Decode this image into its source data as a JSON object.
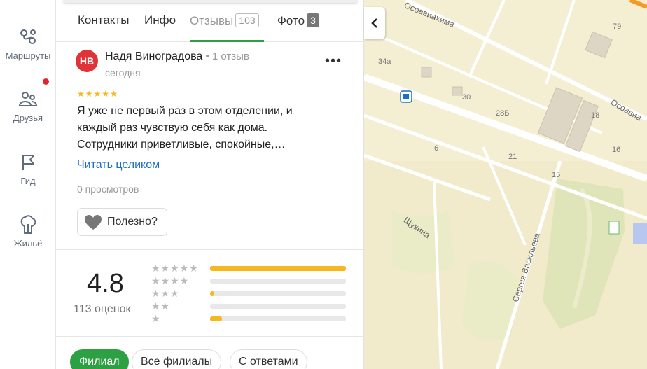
{
  "sidebar": {
    "items": [
      {
        "label": "Маршруты",
        "icon": "routes-icon"
      },
      {
        "label": "Друзья",
        "icon": "friends-icon",
        "badge_color": "#e0262c"
      },
      {
        "label": "Гид",
        "icon": "flag-icon"
      },
      {
        "label": "Жильё",
        "icon": "housing-icon"
      }
    ]
  },
  "tabs": [
    {
      "label": "Контакты"
    },
    {
      "label": "Инфо"
    },
    {
      "label": "Отзывы",
      "count": "103",
      "active": true
    },
    {
      "label": "Фото",
      "count": "3"
    }
  ],
  "review": {
    "avatar_initials": "НВ",
    "avatar_color": "#e03337",
    "author": "Надя Виноградова",
    "reviews_count": " • 1 отзыв",
    "date": "сегодня",
    "rating": 5,
    "text": "Я уже не первый раз в этом отделении, и каждый раз чувствую себя как дома. Сотрудники приветливые, спокойные,…",
    "read_more": "Читать целиком",
    "views": "0 просмотров",
    "useful_label": "Полезно?"
  },
  "rating_summary": {
    "score": "4.8",
    "total": "113 оценок",
    "distribution": [
      {
        "stars": 5,
        "fraction": 1.0
      },
      {
        "stars": 4,
        "fraction": 0.0
      },
      {
        "stars": 3,
        "fraction": 0.03
      },
      {
        "stars": 2,
        "fraction": 0.0
      },
      {
        "stars": 1,
        "fraction": 0.09
      }
    ]
  },
  "filters": [
    {
      "label": "Филиал",
      "active": true
    },
    {
      "label": "Все филиалы"
    },
    {
      "label": "С ответами"
    }
  ],
  "map": {
    "streets": [
      "Осоавиахима",
      "Осоавиа",
      "Щукина",
      "Сергея Васильева"
    ],
    "house_numbers": [
      "79",
      "34а",
      "30",
      "28Б",
      "18",
      "16",
      "6",
      "21",
      "15"
    ]
  },
  "colors": {
    "accent": "#2da044",
    "star": "#f6b71f",
    "link": "#1c6fc9"
  }
}
